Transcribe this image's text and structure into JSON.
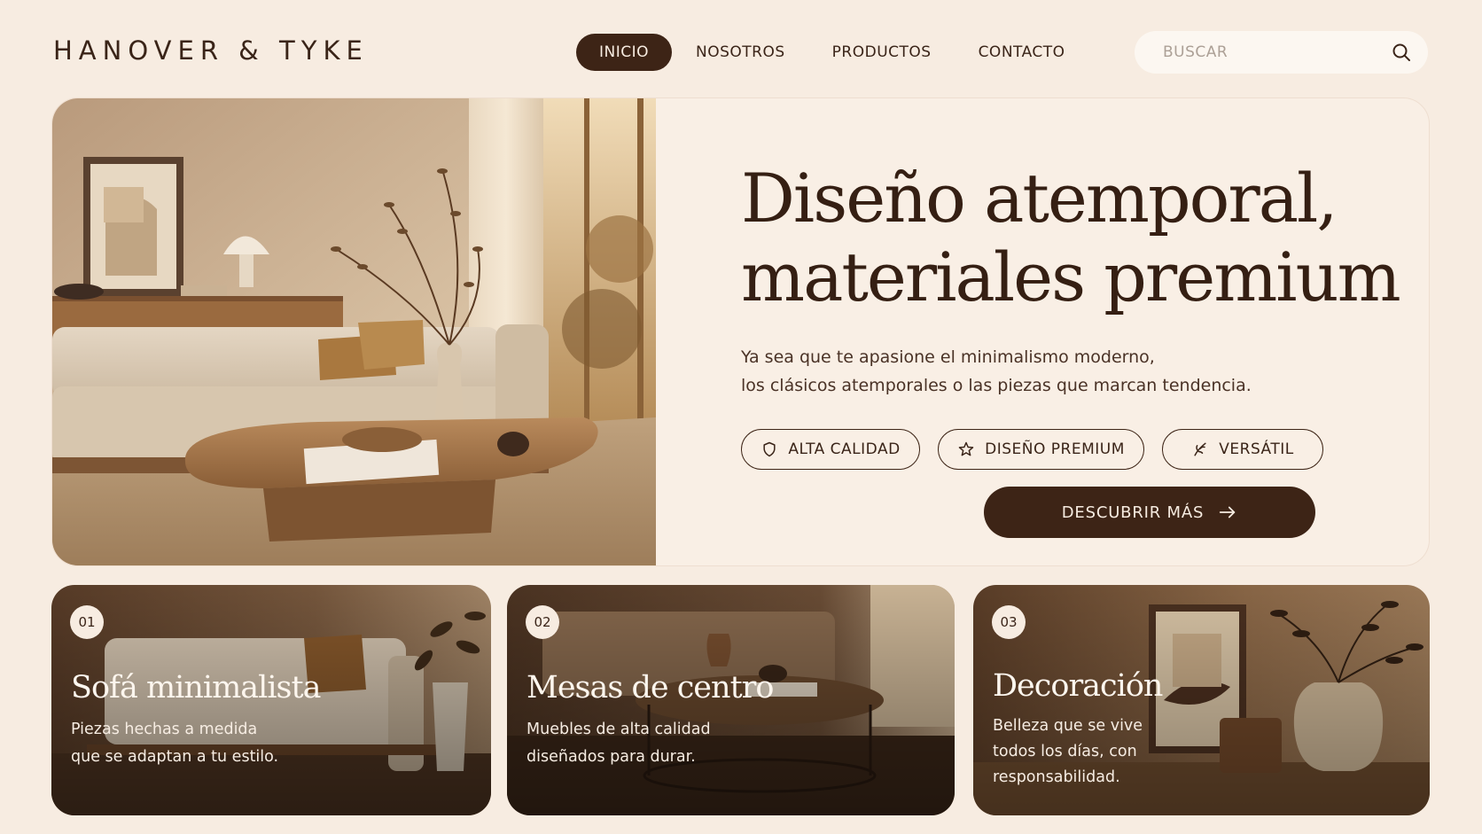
{
  "brand": "HANOVER & TYKE",
  "nav": {
    "items": [
      {
        "label": "INICIO",
        "active": true
      },
      {
        "label": "NOSOTROS",
        "active": false
      },
      {
        "label": "PRODUCTOS",
        "active": false
      },
      {
        "label": "CONTACTO",
        "active": false
      }
    ]
  },
  "search": {
    "placeholder": "BUSCAR",
    "value": "",
    "icon": "search-icon"
  },
  "hero": {
    "title_line1": "Diseño atemporal,",
    "title_line2": "materiales premium",
    "subtitle_line1": "Ya sea que te apasione el minimalismo moderno,",
    "subtitle_line2": "los clásicos atemporales o las piezas que marcan tendencia.",
    "features": [
      {
        "label": "ALTA CALIDAD",
        "icon": "shield-icon"
      },
      {
        "label": "DISEÑO PREMIUM",
        "icon": "star-icon"
      },
      {
        "label": "VERSÁTIL",
        "icon": "leaf-icon"
      }
    ],
    "cta_label": "DESCUBRIR MÁS",
    "cta_icon": "arrow-right-icon"
  },
  "cards": [
    {
      "number": "01",
      "title": "Sofá minimalista",
      "desc_line1": "Piezas hechas a medida",
      "desc_line2": "que se adaptan a tu estilo."
    },
    {
      "number": "02",
      "title": "Mesas de centro",
      "desc_line1": "Muebles de alta calidad",
      "desc_line2": "diseñados para durar."
    },
    {
      "number": "03",
      "title": "Decoración",
      "desc_line1": "Belleza que se vive",
      "desc_line2": "todos los días, con",
      "desc_line3": "responsabilidad."
    }
  ],
  "colors": {
    "background": "#f7ece1",
    "primary_dark": "#3d2416",
    "text": "#3a2418",
    "card_surface": "#f9efe5"
  }
}
